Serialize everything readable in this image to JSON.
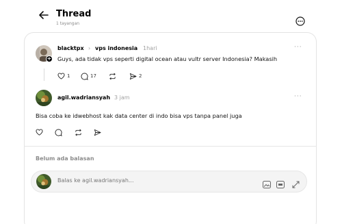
{
  "header": {
    "title": "Thread",
    "views": "1 tayangan"
  },
  "post": {
    "username": "blacktpx",
    "community": "vps indonesia",
    "time": "1hari",
    "text": "Guys, ada tidak vps seperti digital ocean atau vultr server Indonesia? Makasih",
    "likes": "1",
    "comments": "17",
    "shares": "2",
    "more": "···"
  },
  "reply": {
    "username": "agil.wadriansyah",
    "time": "3 jam",
    "text": "Bisa coba ke idwebhost kak data center di indo bisa vps tanpa panel juga",
    "more": "···"
  },
  "no_replies": "Belum ada balasan",
  "compose": {
    "placeholder": "Balas ke agil.wadriansyah..."
  },
  "colors": {
    "text": "#000000",
    "muted": "#999999",
    "border": "#e3e3e3"
  },
  "icons": [
    "back-arrow-icon",
    "more-circle-icon",
    "heart-icon",
    "comment-icon",
    "repost-icon",
    "share-icon",
    "image-icon",
    "gif-icon",
    "expand-icon"
  ]
}
